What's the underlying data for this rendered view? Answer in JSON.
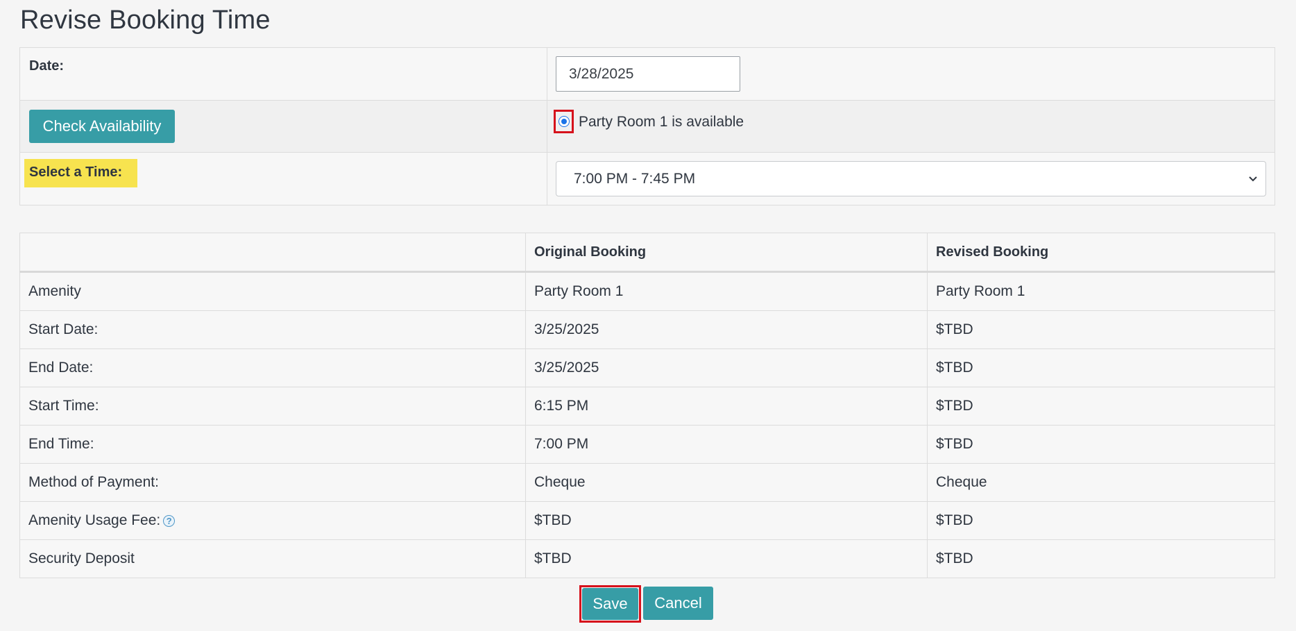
{
  "page": {
    "title": "Revise Booking Time"
  },
  "form": {
    "date_label": "Date:",
    "date_value": "3/28/2025",
    "check_button": "Check Availability",
    "availability_text": "Party Room 1 is available",
    "time_label": "Select a Time:",
    "time_selected": "7:00 PM - 7:45 PM"
  },
  "booking_table": {
    "headers": [
      "",
      "Original Booking",
      "Revised Booking"
    ],
    "rows": [
      {
        "label": "Amenity",
        "original": "Party Room 1",
        "revised": "Party Room 1"
      },
      {
        "label": "Start Date:",
        "original": "3/25/2025",
        "revised": "$TBD"
      },
      {
        "label": "End Date:",
        "original": "3/25/2025",
        "revised": "$TBD"
      },
      {
        "label": "Start Time:",
        "original": "6:15 PM",
        "revised": "$TBD"
      },
      {
        "label": "End Time:",
        "original": "7:00 PM",
        "revised": "$TBD"
      },
      {
        "label": "Method of Payment:",
        "original": "Cheque",
        "revised": "Cheque"
      },
      {
        "label": "Amenity Usage Fee:",
        "original": "$TBD",
        "revised": "$TBD",
        "help_icon": "question-circle-icon"
      },
      {
        "label": "Security Deposit",
        "original": "$TBD",
        "revised": "$TBD"
      }
    ]
  },
  "actions": {
    "save": "Save",
    "cancel": "Cancel"
  },
  "colors": {
    "primary_button": "#379da6",
    "highlight": "#f7e34f",
    "annotation_border": "#d6121c"
  }
}
